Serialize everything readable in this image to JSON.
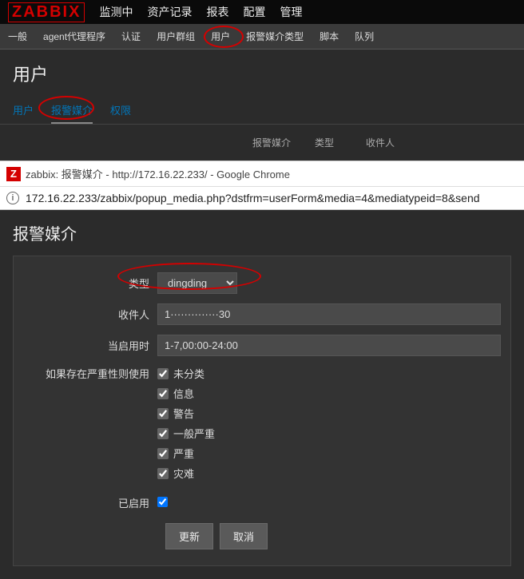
{
  "logo": "ZABBIX",
  "topnav": [
    "监测中",
    "资产记录",
    "报表",
    "配置",
    "管理"
  ],
  "subnav": [
    "一般",
    "agent代理程序",
    "认证",
    "用户群组",
    "用户",
    "报警媒介类型",
    "脚本",
    "队列"
  ],
  "page_title": "用户",
  "tabs": {
    "user": "用户",
    "media": "报警媒介",
    "perm": "权限"
  },
  "table": {
    "media": "报警媒介",
    "type": "类型",
    "recipient": "收件人"
  },
  "browser": {
    "title": "zabbix: 报警媒介 - http://172.16.22.233/ - Google Chrome",
    "url": "172.16.22.233/zabbix/popup_media.php?dstfrm=userForm&media=4&mediatypeid=8&send"
  },
  "popup_title": "报警媒介",
  "form": {
    "type_label": "类型",
    "type_value": "dingding",
    "sendto_label": "收件人",
    "sendto_value": "1··············30",
    "active_label": "当启用时",
    "active_value": "1-7,00:00-24:00",
    "severity_label": "如果存在严重性则使用",
    "severities": [
      "未分类",
      "信息",
      "警告",
      "一般严重",
      "严重",
      "灾难"
    ],
    "enabled_label": "已启用"
  },
  "buttons": {
    "update": "更新",
    "cancel": "取消"
  }
}
